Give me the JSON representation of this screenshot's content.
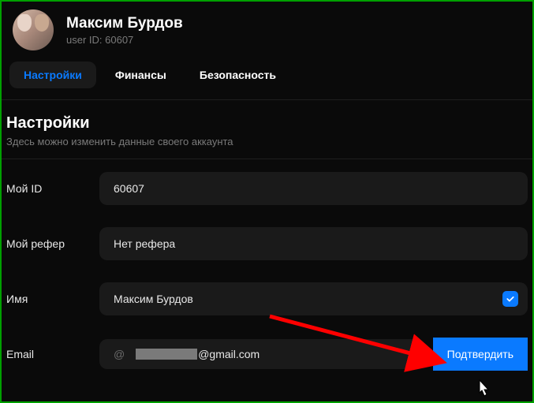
{
  "user": {
    "name": "Максим Бурдов",
    "id_label": "user ID: 60607"
  },
  "tabs": {
    "settings": "Настройки",
    "finance": "Финансы",
    "security": "Безопасность"
  },
  "section": {
    "title": "Настройки",
    "subtitle": "Здесь можно изменить данные своего аккаунта"
  },
  "fields": {
    "my_id": {
      "label": "Мой ID",
      "value": "60607"
    },
    "referrer": {
      "label": "Мой рефер",
      "value": "Нет рефера"
    },
    "name": {
      "label": "Имя",
      "value": "Максим Бурдов"
    },
    "email": {
      "label": "Email",
      "domain": "@gmail.com"
    }
  },
  "buttons": {
    "confirm": "Подтвердить"
  }
}
